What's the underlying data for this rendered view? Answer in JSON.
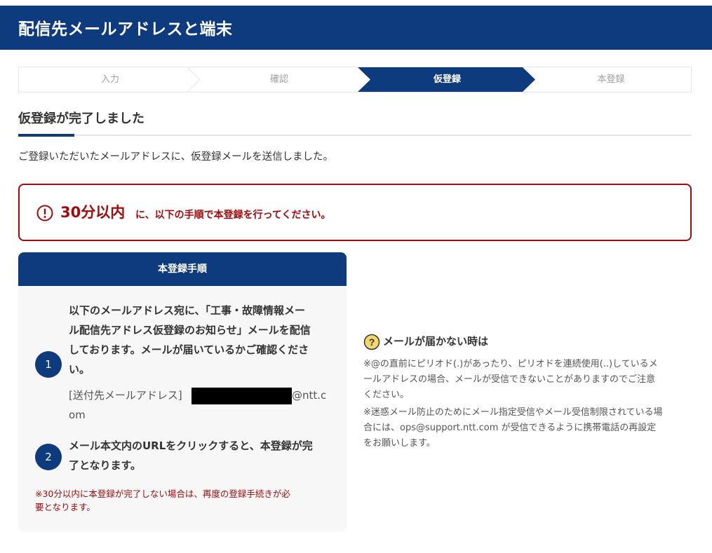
{
  "header": {
    "title": "配信先メールアドレスと端末"
  },
  "steps": [
    {
      "label": "入力",
      "active": false
    },
    {
      "label": "確認",
      "active": false
    },
    {
      "label": "仮登録",
      "active": true
    },
    {
      "label": "本登録",
      "active": false
    }
  ],
  "section": {
    "title": "仮登録が完了しました",
    "intro": "ご登録いただいたメールアドレスに、仮登録メールを送信しました。"
  },
  "alert": {
    "icon": "exclamation-circle-icon",
    "emphasis": "30分以内",
    "message": "に、以下の手順で本登録を行ってください。",
    "color": "#a4090b"
  },
  "procedure": {
    "title": "本登録手順",
    "step1": {
      "number": "1",
      "lines": [
        "以下のメールアドレス宛に、「工事・故障情報メー",
        "ル配信先アドレス仮登録のお知らせ」メールを配信",
        "しております。メールが届いているかご確認くださ",
        "い。"
      ],
      "address_label": "[送付先メールアドレス]",
      "address_domain": "@ntt.c",
      "address_domain_cont": "om"
    },
    "step2": {
      "number": "2",
      "lines": [
        "メール本文内のURLをクリックすると、本登録が完",
        "了となります。"
      ]
    },
    "note_lines": [
      "※30分以内に本登録が完了しない場合は、再度の登録手続きが必",
      "要となります。"
    ]
  },
  "help": {
    "icon": "question-circle-icon",
    "title": "メールが届かない時は",
    "note1_lines": [
      "※@の直前にピリオド(.)があったり、ピリオドを連続使用(..)しているメ",
      "ールアドレスの場合、メールが受信できないことがありますのでご注意",
      "ください。"
    ],
    "note2_lines": [
      "※迷惑メール防止のためにメール指定受信やメール受信制限されている場",
      "合には、ops@support.ntt.com が受信できるように携帯電話の再設定",
      "をお願いします。"
    ]
  },
  "colors": {
    "brand": "#0e3a7e",
    "alert": "#a4090b",
    "card_bg": "#f7f7f7",
    "help_icon": "#f5d76e"
  }
}
